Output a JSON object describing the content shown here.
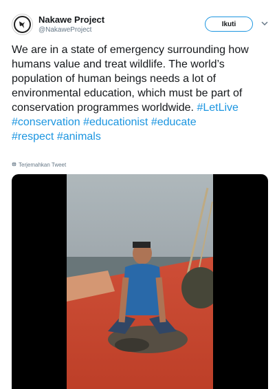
{
  "author": {
    "name": "Nakawe Project",
    "handle": "@NakaweProject"
  },
  "follow_label": "Ikuti",
  "tweet": {
    "line1": "We are in a state of emergency surrounding how humans value and treat wildlife. The world’s population of human beings needs a lot of environmental education, which must be part of conservation programmes worldwide. ",
    "tag_letlive": "#LetLive",
    "tag_conservation": "#conservation",
    "tag_educationist": "#educationist",
    "tag_educate": "#educate",
    "tag_respect": "#respect",
    "tag_animals": "#animals"
  },
  "translate_label": "Terjemahkan Tweet",
  "colors": {
    "link": "#1b95e0",
    "text": "#14171a",
    "muted": "#657786"
  },
  "icons": {
    "avatar": "hummingbird-logo",
    "caret": "chevron-down-icon",
    "translate": "globe-icon"
  }
}
